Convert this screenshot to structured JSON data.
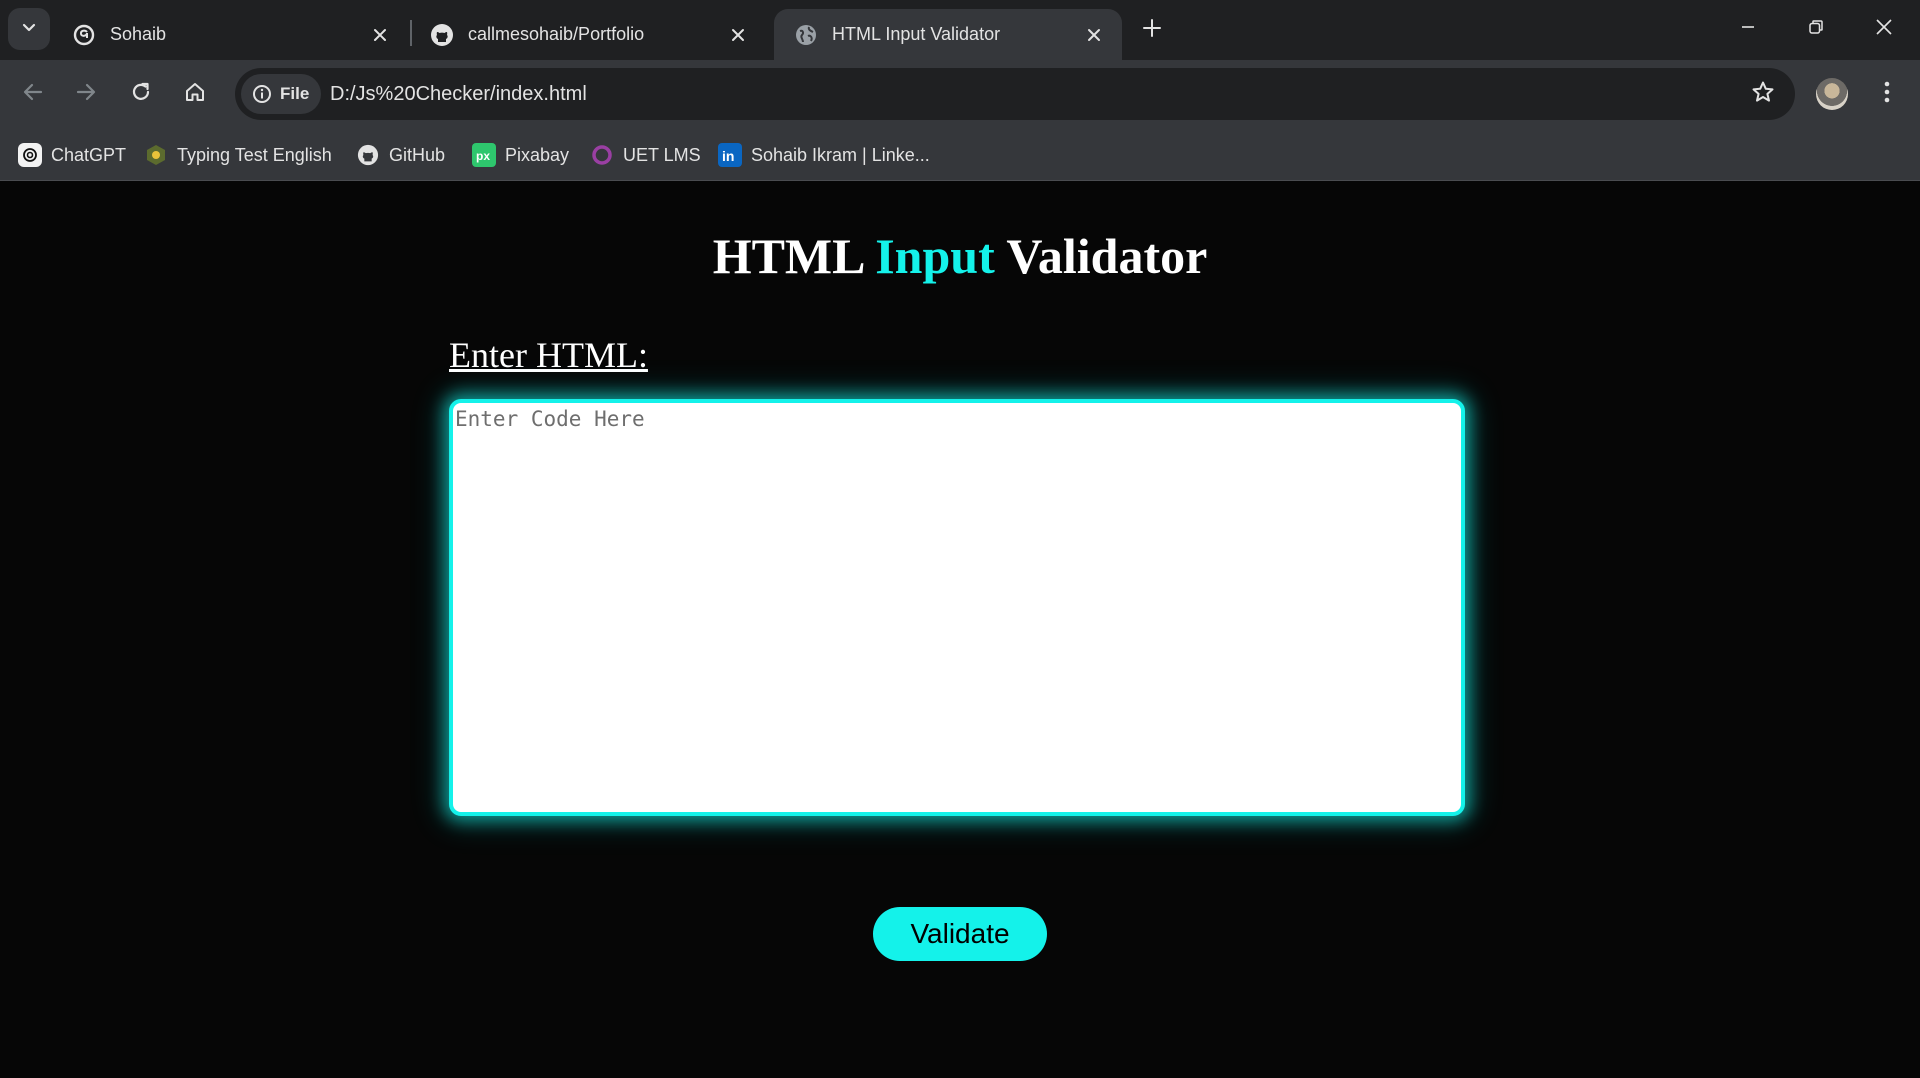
{
  "browser": {
    "tabs": [
      {
        "title": "Sohaib",
        "icon": "threads-icon",
        "active": false
      },
      {
        "title": "callmesohaib/Portfolio",
        "icon": "github-icon",
        "active": false
      },
      {
        "title": "HTML Input Validator",
        "icon": "globe-icon",
        "active": true
      }
    ],
    "chip_label": "File",
    "url": "D:/Js%20Checker/index.html",
    "bookmarks": [
      {
        "label": "ChatGPT",
        "icon": "chatgpt-icon"
      },
      {
        "label": "Typing Test English",
        "icon": "typing-test-icon"
      },
      {
        "label": "GitHub",
        "icon": "github-icon"
      },
      {
        "label": "Pixabay",
        "icon": "pixabay-icon"
      },
      {
        "label": "UET LMS",
        "icon": "lms-icon"
      },
      {
        "label": "Sohaib Ikram | Linke...",
        "icon": "linkedin-icon"
      }
    ]
  },
  "page": {
    "heading_part1": "HTML",
    "heading_accent": "Input",
    "heading_part2": "Validator",
    "label": "Enter HTML:",
    "textarea_value": "",
    "textarea_placeholder": "Enter Code Here",
    "validate_label": "Validate"
  },
  "colors": {
    "accent": "#14f2ea",
    "page_background": "#060606",
    "browser_frame": "#1f2022",
    "toolbar": "#35373b"
  }
}
